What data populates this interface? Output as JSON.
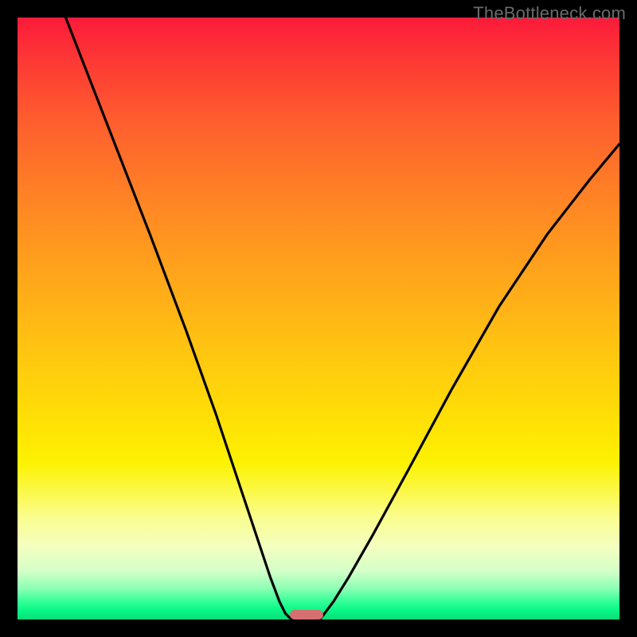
{
  "watermark": "TheBottleneck.com",
  "colors": {
    "frame_bg_top": "#fb1a3a",
    "frame_bg_bottom": "#0bdb78",
    "curve_stroke": "#000000",
    "marker_fill": "#d56f70",
    "page_bg": "#000000",
    "watermark_color": "#6a6a6a"
  },
  "chart_data": {
    "type": "line",
    "title": "",
    "xlabel": "",
    "ylabel": "",
    "xlim": [
      0,
      100
    ],
    "ylim": [
      0,
      100
    ],
    "grid": false,
    "legend": false,
    "series": [
      {
        "name": "left-curve",
        "x": [
          8,
          15,
          22,
          28,
          33,
          37,
          40,
          42,
          43.5,
          44.5,
          45.2,
          45.8
        ],
        "y": [
          100,
          82,
          64,
          48,
          34,
          22,
          13,
          7,
          3,
          1,
          0.3,
          0
        ]
      },
      {
        "name": "right-curve",
        "x": [
          50.2,
          51,
          52.5,
          55,
          59,
          65,
          72,
          80,
          88,
          95,
          100
        ],
        "y": [
          0,
          1,
          3,
          7,
          14,
          25,
          38,
          52,
          64,
          73,
          79
        ]
      }
    ],
    "marker": {
      "x_center": 48,
      "y": 0,
      "width_pct": 5.5,
      "height_pct": 1.6
    },
    "background_gradient": "vertical red→orange→yellow→green"
  }
}
